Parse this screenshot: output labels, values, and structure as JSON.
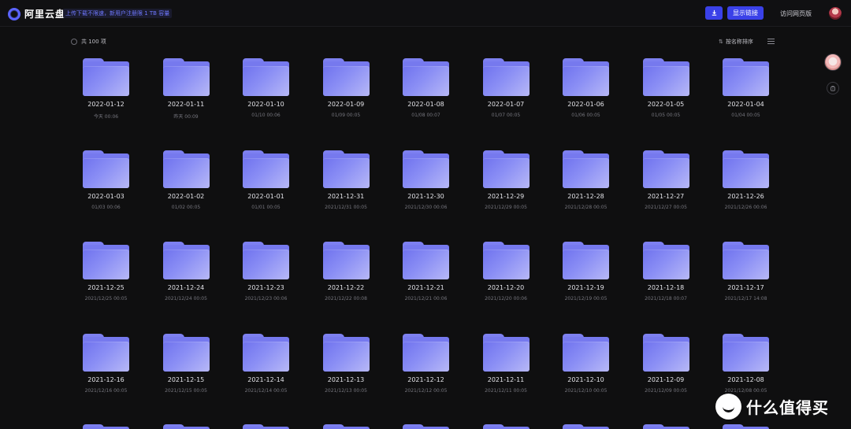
{
  "header": {
    "logo_text": "阿里云盘",
    "notice": "上传下载不限速，新用户注册限 1 TB 容量",
    "download_icon": "download-icon",
    "share_label": "显示链接",
    "web_label": "访问网页版",
    "avatar": "user-avatar"
  },
  "list": {
    "count_label": "共 100 项",
    "sort_label": "按名称排序",
    "sort_icon": "⇅",
    "view_icon": "list-view-icon"
  },
  "folders": [
    {
      "name": "2022-01-12",
      "time": "今天 00:06"
    },
    {
      "name": "2022-01-11",
      "time": "昨天 00:09"
    },
    {
      "name": "2022-01-10",
      "time": "01/10 00:06"
    },
    {
      "name": "2022-01-09",
      "time": "01/09 00:05"
    },
    {
      "name": "2022-01-08",
      "time": "01/08 00:07"
    },
    {
      "name": "2022-01-07",
      "time": "01/07 00:05"
    },
    {
      "name": "2022-01-06",
      "time": "01/06 00:05"
    },
    {
      "name": "2022-01-05",
      "time": "01/05 00:05"
    },
    {
      "name": "2022-01-04",
      "time": "01/04 00:05"
    },
    {
      "name": "2022-01-03",
      "time": "01/03 00:06"
    },
    {
      "name": "2022-01-02",
      "time": "01/02 00:05"
    },
    {
      "name": "2022-01-01",
      "time": "01/01 00:05"
    },
    {
      "name": "2021-12-31",
      "time": "2021/12/31 00:05"
    },
    {
      "name": "2021-12-30",
      "time": "2021/12/30 00:06"
    },
    {
      "name": "2021-12-29",
      "time": "2021/12/29 00:05"
    },
    {
      "name": "2021-12-28",
      "time": "2021/12/28 00:05"
    },
    {
      "name": "2021-12-27",
      "time": "2021/12/27 00:05"
    },
    {
      "name": "2021-12-26",
      "time": "2021/12/26 00:06"
    },
    {
      "name": "2021-12-25",
      "time": "2021/12/25 00:05"
    },
    {
      "name": "2021-12-24",
      "time": "2021/12/24 00:05"
    },
    {
      "name": "2021-12-23",
      "time": "2021/12/23 00:06"
    },
    {
      "name": "2021-12-22",
      "time": "2021/12/22 00:08"
    },
    {
      "name": "2021-12-21",
      "time": "2021/12/21 00:06"
    },
    {
      "name": "2021-12-20",
      "time": "2021/12/20 00:06"
    },
    {
      "name": "2021-12-19",
      "time": "2021/12/19 00:05"
    },
    {
      "name": "2021-12-18",
      "time": "2021/12/18 00:07"
    },
    {
      "name": "2021-12-17",
      "time": "2021/12/17 14:08"
    },
    {
      "name": "2021-12-16",
      "time": "2021/12/16 00:05"
    },
    {
      "name": "2021-12-15",
      "time": "2021/12/15 00:05"
    },
    {
      "name": "2021-12-14",
      "time": "2021/12/14 00:05"
    },
    {
      "name": "2021-12-13",
      "time": "2021/12/13 00:05"
    },
    {
      "name": "2021-12-12",
      "time": "2021/12/12 00:05"
    },
    {
      "name": "2021-12-11",
      "time": "2021/12/11 00:05"
    },
    {
      "name": "2021-12-10",
      "time": "2021/12/10 00:05"
    },
    {
      "name": "2021-12-09",
      "time": "2021/12/09 00:05"
    },
    {
      "name": "2021-12-08",
      "time": "2021/12/08 00:05"
    }
  ],
  "watermark": {
    "text": "什么值得买",
    "icon": "smzdm-logo-icon"
  },
  "colors": {
    "accent": "#3a41e8",
    "folder": "#7679ee",
    "background": "#0f0f10"
  }
}
